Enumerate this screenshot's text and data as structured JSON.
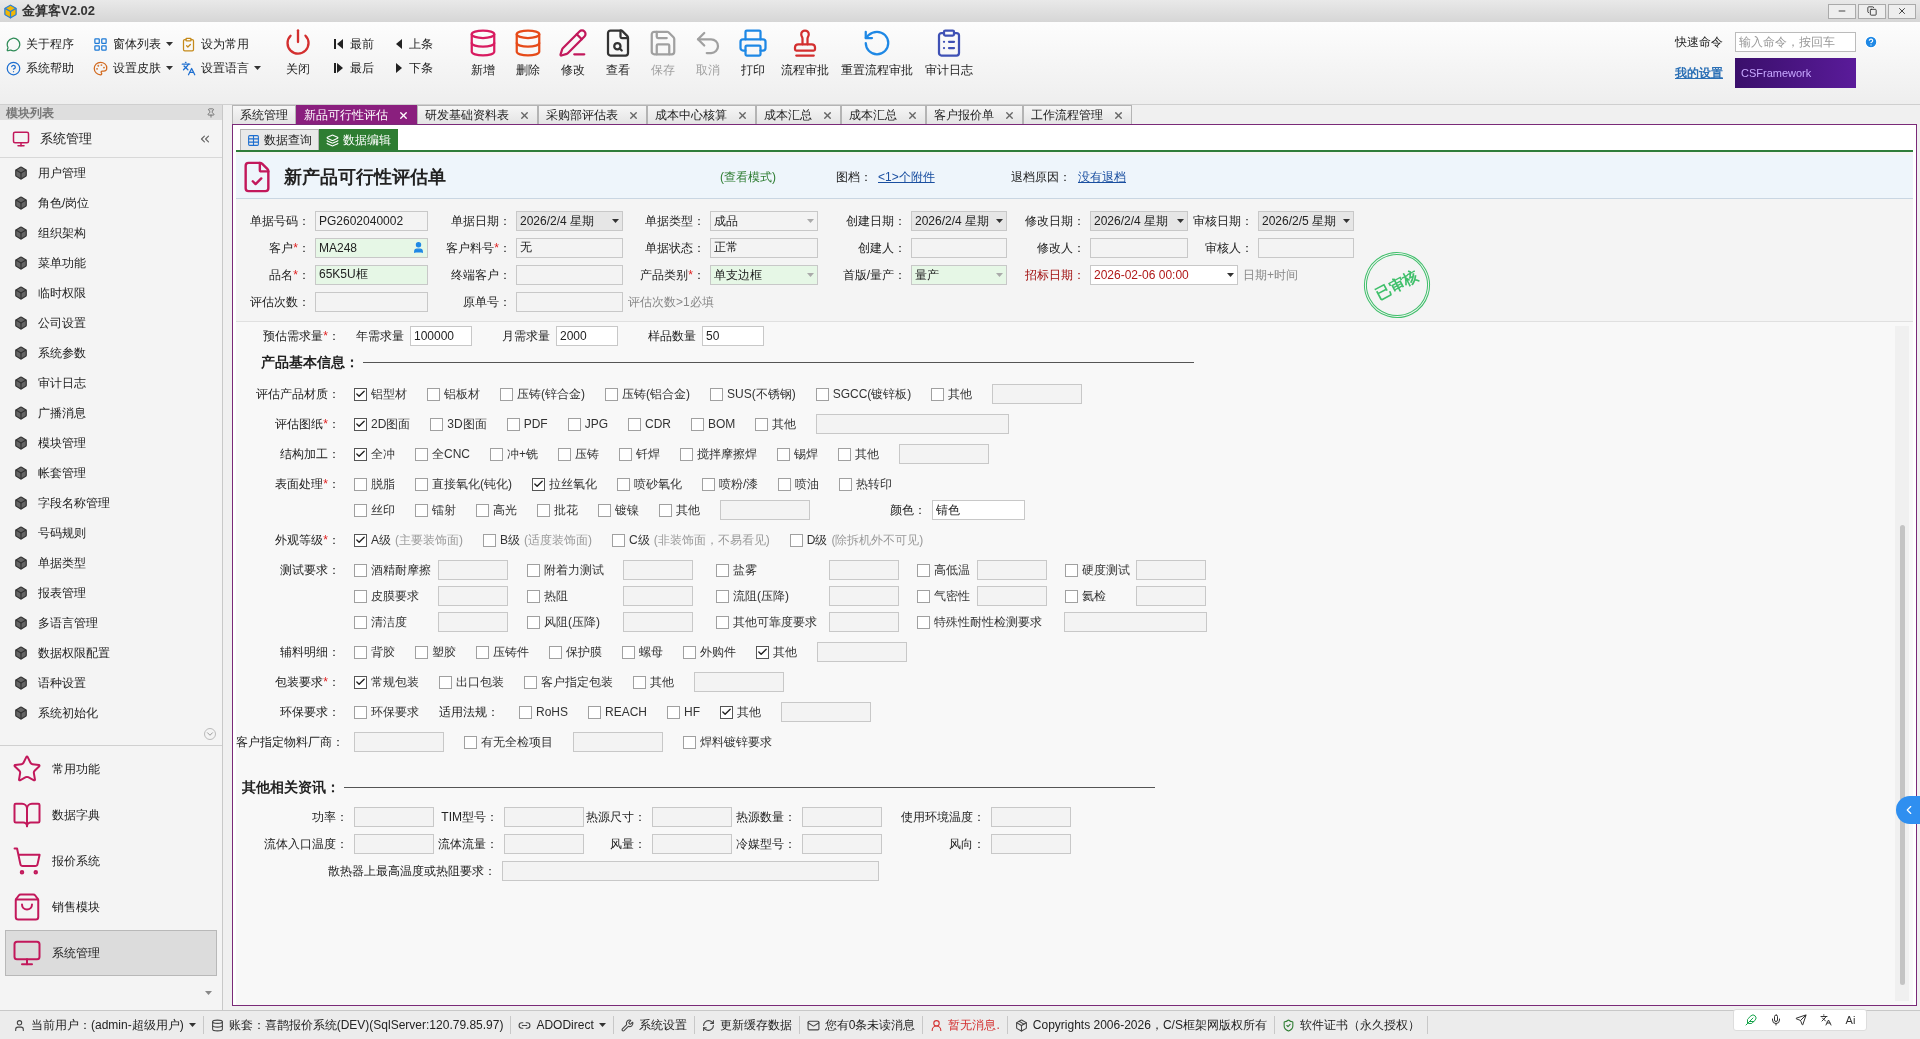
{
  "window": {
    "title": "金算客V2.02"
  },
  "ribbon": {
    "small_buttons": [
      {
        "label": "关于程序",
        "dropdown": false
      },
      {
        "label": "窗体列表",
        "dropdown": true
      },
      {
        "label": "设为常用",
        "dropdown": false
      },
      {
        "label": "系统帮助",
        "dropdown": false
      },
      {
        "label": "设置皮肤",
        "dropdown": true
      },
      {
        "label": "设置语言",
        "dropdown": true
      }
    ],
    "close_button": {
      "label": "关闭"
    },
    "nav_buttons": [
      {
        "label": "最前"
      },
      {
        "label": "上条"
      },
      {
        "label": "最后"
      },
      {
        "label": "下条"
      }
    ],
    "buttons": [
      {
        "label": "新增",
        "disabled": false
      },
      {
        "label": "删除",
        "disabled": false
      },
      {
        "label": "修改",
        "disabled": false
      },
      {
        "label": "查看",
        "disabled": false
      },
      {
        "label": "保存",
        "disabled": true
      },
      {
        "label": "取消",
        "disabled": true
      },
      {
        "label": "打印",
        "disabled": false
      },
      {
        "label": "流程审批",
        "disabled": false
      },
      {
        "label": "重置流程审批",
        "disabled": false
      },
      {
        "label": "审计日志",
        "disabled": false
      }
    ],
    "quick_command": {
      "label": "快速命令",
      "placeholder": "输入命令，按回车"
    },
    "settings_link": "我的设置",
    "banner": "CSFramework"
  },
  "sidebar": {
    "title": "模块列表",
    "group": "系统管理",
    "items": [
      {
        "label": "用户管理"
      },
      {
        "label": "角色/岗位"
      },
      {
        "label": "组织架构"
      },
      {
        "label": "菜单功能"
      },
      {
        "label": "临时权限"
      },
      {
        "label": "公司设置"
      },
      {
        "label": "系统参数"
      },
      {
        "label": "审计日志"
      },
      {
        "label": "广播消息"
      },
      {
        "label": "模块管理"
      },
      {
        "label": "帐套管理"
      },
      {
        "label": "字段名称管理"
      },
      {
        "label": "号码规则"
      },
      {
        "label": "单据类型"
      },
      {
        "label": "报表管理"
      },
      {
        "label": "多语言管理"
      },
      {
        "label": "数据权限配置"
      },
      {
        "label": "语种设置"
      },
      {
        "label": "系统初始化"
      }
    ],
    "modules": [
      {
        "label": "常用功能",
        "selected": false
      },
      {
        "label": "数据字典",
        "selected": false
      },
      {
        "label": "报价系统",
        "selected": false
      },
      {
        "label": "销售模块",
        "selected": false
      },
      {
        "label": "系统管理",
        "selected": true
      }
    ]
  },
  "tabs": [
    {
      "label": "系统管理",
      "selected": false,
      "closable": false
    },
    {
      "label": "新品可行性评估",
      "selected": true,
      "closable": true
    },
    {
      "label": "研发基础资料表",
      "selected": false,
      "closable": true
    },
    {
      "label": "采购部评估表",
      "selected": false,
      "closable": true
    },
    {
      "label": "成本中心核算",
      "selected": false,
      "closable": true
    },
    {
      "label": "成本汇总",
      "selected": false,
      "closable": true
    },
    {
      "label": "成本汇总",
      "selected": false,
      "closable": true
    },
    {
      "label": "客户报价单",
      "selected": false,
      "closable": true
    },
    {
      "label": "工作流程管理",
      "selected": false,
      "closable": true
    }
  ],
  "view_tabs": [
    {
      "label": "数据查询",
      "selected": false
    },
    {
      "label": "数据编辑",
      "selected": true
    }
  ],
  "form": {
    "title": "新产品可行性评估单",
    "mode": "(查看模式)",
    "attachments_label": "图档：",
    "attachments_link": "<1>个附件",
    "return_label": "退档原因：",
    "return_link": "没有退档",
    "stamp": "已审核",
    "header_rows": [
      [
        {
          "label": "单据号码：",
          "kind": "text",
          "value": "PG2602040002",
          "highlighted": false,
          "emphasis": false
        },
        {
          "label": "单据日期：",
          "kind": "date",
          "value": "2026/2/4 星期",
          "highlighted": false,
          "emphasis": false
        },
        {
          "label": "单据类型：",
          "kind": "dropdown",
          "value": "成品",
          "highlighted": false,
          "emphasis": false
        },
        {
          "label": "创建日期：",
          "kind": "date",
          "value": "2026/2/4 星期",
          "highlighted": false,
          "emphasis": false
        },
        {
          "label": "修改日期：",
          "kind": "date",
          "value": "2026/2/4 星期",
          "highlighted": false,
          "emphasis": false
        },
        {
          "label": "审核日期：",
          "kind": "date",
          "value": "2026/2/5 星期",
          "highlighted": false,
          "emphasis": false
        }
      ],
      [
        {
          "label": "客户",
          "mark": "*",
          "colon": "：",
          "kind": "lookup",
          "value": "MA248",
          "highlighted": true,
          "emphasis": false
        },
        {
          "label": "客户料号",
          "mark": "*",
          "colon": "：",
          "kind": "text",
          "value": "无",
          "highlighted": false,
          "emphasis": false
        },
        {
          "label": "单据状态：",
          "kind": "text",
          "value": "正常",
          "highlighted": false,
          "emphasis": false
        },
        {
          "label": "创建人：",
          "kind": "text",
          "highlighted": false,
          "emphasis": false
        },
        {
          "label": "修改人：",
          "kind": "text",
          "highlighted": false,
          "emphasis": false
        },
        {
          "label": "审核人：",
          "kind": "text",
          "highlighted": false,
          "emphasis": false
        }
      ],
      [
        {
          "label": "品名",
          "mark": "*",
          "colon": "：",
          "kind": "text",
          "value": "65K5U框",
          "highlighted": true,
          "emphasis": false
        },
        {
          "label": "终端客户：",
          "kind": "text",
          "highlighted": false,
          "emphasis": false
        },
        {
          "label": "产品类别",
          "mark": "*",
          "colon": "：",
          "kind": "dropdown",
          "value": "单支边框",
          "highlighted": true,
          "emphasis": false
        },
        {
          "label": "首版/量产：",
          "kind": "dropdown",
          "value": "量产",
          "highlighted": true,
          "emphasis": false
        },
        {
          "label": "招标日期：",
          "kind": "datetime",
          "value": "2026-02-06 00:00",
          "hint": "日期+时间",
          "highlighted": false,
          "emphasis": true
        }
      ],
      [
        {
          "label": "评估次数：",
          "kind": "text",
          "highlighted": false,
          "emphasis": false
        },
        {
          "label": "原单号：",
          "kind": "text",
          "hint": "评估次数>1必填",
          "highlighted": false,
          "emphasis": false
        }
      ]
    ],
    "demand": {
      "label": "预估需求量",
      "mark": "*",
      "colon": "：",
      "fields": [
        {
          "label": "年需求量",
          "value": "100000"
        },
        {
          "label": "月需求量",
          "value": "2000"
        },
        {
          "label": "样品数量",
          "value": "50"
        }
      ]
    },
    "basic_info": {
      "title": "产品基本信息：",
      "rows": [
        {
          "label": "评估产品材质：",
          "lines": [
            [
              {
                "kind": "check",
                "label": "铝型材",
                "checked": true
              },
              {
                "kind": "check",
                "label": "铝板材",
                "checked": false
              },
              {
                "kind": "check",
                "label": "压铸(锌合金)",
                "checked": false
              },
              {
                "kind": "check",
                "label": "压铸(铝合金)",
                "checked": false
              },
              {
                "kind": "check",
                "label": "SUS(不锈钢)",
                "checked": false
              },
              {
                "kind": "check",
                "label": "SGCC(镀锌板)",
                "checked": false
              },
              {
                "kind": "check",
                "label": "其他",
                "checked": false
              },
              {
                "kind": "field"
              }
            ]
          ]
        },
        {
          "label": "评估图纸",
          "mark": "*",
          "colon": "：",
          "lines": [
            [
              {
                "kind": "check",
                "label": "2D图面",
                "checked": true
              },
              {
                "kind": "check",
                "label": "3D图面",
                "checked": false
              },
              {
                "kind": "check",
                "label": "PDF",
                "checked": false
              },
              {
                "kind": "check",
                "label": "JPG",
                "checked": false
              },
              {
                "kind": "check",
                "label": "CDR",
                "checked": false
              },
              {
                "kind": "check",
                "label": "BOM",
                "checked": false
              },
              {
                "kind": "check",
                "label": "其他",
                "checked": false
              },
              {
                "kind": "wide_field"
              }
            ]
          ]
        },
        {
          "label": "结构加工：",
          "lines": [
            [
              {
                "kind": "check",
                "label": "全冲",
                "checked": true
              },
              {
                "kind": "check",
                "label": "全CNC",
                "checked": false
              },
              {
                "kind": "check",
                "label": "冲+铣",
                "checked": false
              },
              {
                "kind": "check",
                "label": "压铸",
                "checked": false
              },
              {
                "kind": "check",
                "label": "钎焊",
                "checked": false
              },
              {
                "kind": "check",
                "label": "搅拌摩擦焊",
                "checked": false
              },
              {
                "kind": "check",
                "label": "锡焊",
                "checked": false
              },
              {
                "kind": "check",
                "label": "其他",
                "checked": false
              },
              {
                "kind": "field"
              }
            ]
          ]
        },
        {
          "label": "表面处理",
          "mark": "*",
          "colon": "：",
          "lines": [
            [
              {
                "kind": "check",
                "label": "脱脂",
                "checked": false
              },
              {
                "kind": "check",
                "label": "直接氧化(钝化)",
                "checked": false
              },
              {
                "kind": "check",
                "label": "拉丝氧化",
                "checked": true
              },
              {
                "kind": "check",
                "label": "喷砂氧化",
                "checked": false
              },
              {
                "kind": "check",
                "label": "喷粉/漆",
                "checked": false
              },
              {
                "kind": "check",
                "label": "喷油",
                "checked": false
              },
              {
                "kind": "check",
                "label": "热转印",
                "checked": false
              }
            ],
            [
              {
                "kind": "check",
                "label": "丝印",
                "checked": false
              },
              {
                "kind": "check",
                "label": "镭射",
                "checked": false
              },
              {
                "kind": "check",
                "label": "高光",
                "checked": false
              },
              {
                "kind": "check",
                "label": "批花",
                "checked": false
              },
              {
                "kind": "check",
                "label": "镀镍",
                "checked": false
              },
              {
                "kind": "check",
                "label": "其他",
                "checked": false
              },
              {
                "kind": "field"
              },
              {
                "kind": "labeled_field",
                "label": "颜色：",
                "value": "锖色"
              }
            ]
          ]
        },
        {
          "label": "外观等级",
          "mark": "*",
          "colon": "：",
          "lines": [
            [
              {
                "kind": "check",
                "label": "A级",
                "note": "(主要装饰面)",
                "checked": true
              },
              {
                "kind": "check",
                "label": "B级",
                "note": "(适度装饰面)",
                "checked": false
              },
              {
                "kind": "check",
                "label": "C级",
                "note": "(非装饰面，不易看见)",
                "checked": false
              },
              {
                "kind": "check",
                "label": "D级",
                "note": "(除拆机外不可见)",
                "checked": false
              }
            ]
          ]
        },
        {
          "label": "测试要求：",
          "lines": [
            [
              {
                "kind": "check_field",
                "label": "酒精耐摩擦",
                "checked": false
              },
              {
                "kind": "check_field",
                "label": "附着力测试",
                "checked": false
              },
              {
                "kind": "check_field",
                "label": "盐雾",
                "checked": false
              },
              {
                "kind": "check_field",
                "label": "高低温",
                "checked": false
              },
              {
                "kind": "check_field",
                "label": "硬度测试",
                "checked": false
              }
            ],
            [
              {
                "kind": "check_field",
                "label": "皮膜要求",
                "checked": false
              },
              {
                "kind": "check_field",
                "label": "热阻",
                "checked": false
              },
              {
                "kind": "check_field",
                "label": "流阻(压降)",
                "checked": false
              },
              {
                "kind": "check_field",
                "label": "气密性",
                "checked": false
              },
              {
                "kind": "check_field",
                "label": "氦检",
                "checked": false
              }
            ],
            [
              {
                "kind": "check_field",
                "label": "清洁度",
                "checked": false
              },
              {
                "kind": "check_field",
                "label": "风阻(压降)",
                "checked": false
              },
              {
                "kind": "check_field",
                "label": "其他可靠度要求",
                "checked": false
              },
              {
                "kind": "check_wide_field",
                "label": "特殊性耐性检测要求",
                "checked": false
              }
            ]
          ]
        },
        {
          "label": "辅料明细：",
          "lines": [
            [
              {
                "kind": "check",
                "label": "背胶",
                "checked": false
              },
              {
                "kind": "check",
                "label": "塑胶",
                "checked": false
              },
              {
                "kind": "check",
                "label": "压铸件",
                "checked": false
              },
              {
                "kind": "check",
                "label": "保护膜",
                "checked": false
              },
              {
                "kind": "check",
                "label": "螺母",
                "checked": false
              },
              {
                "kind": "check",
                "label": "外购件",
                "checked": false
              },
              {
                "kind": "check",
                "label": "其他",
                "checked": true
              },
              {
                "kind": "field"
              }
            ]
          ]
        },
        {
          "label": "包装要求",
          "mark": "*",
          "colon": "：",
          "lines": [
            [
              {
                "kind": "check",
                "label": "常规包装",
                "checked": true
              },
              {
                "kind": "check",
                "label": "出口包装",
                "checked": false
              },
              {
                "kind": "check",
                "label": "客户指定包装",
                "checked": false
              },
              {
                "kind": "check",
                "label": "其他",
                "checked": false
              },
              {
                "kind": "field"
              }
            ]
          ]
        },
        {
          "label": "环保要求：",
          "lines": [
            [
              {
                "kind": "check",
                "label": "环保要求",
                "checked": false
              },
              {
                "kind": "text",
                "label": "适用法规："
              },
              {
                "kind": "check",
                "label": "RoHS",
                "checked": false
              },
              {
                "kind": "check",
                "label": "REACH",
                "checked": false
              },
              {
                "kind": "check",
                "label": "HF",
                "checked": false
              },
              {
                "kind": "check",
                "label": "其他",
                "checked": true
              },
              {
                "kind": "field"
              }
            ]
          ]
        },
        {
          "label": "客户指定物料厂商：",
          "lines": [
            [
              {
                "kind": "field"
              },
              {
                "kind": "check",
                "label": "有无全检项目",
                "checked": false
              },
              {
                "kind": "field"
              },
              {
                "kind": "check",
                "label": "焊料镀锌要求",
                "checked": false
              }
            ]
          ]
        }
      ]
    },
    "other_info": {
      "title": "其他相关资讯：",
      "rows": [
        [
          {
            "label": "功率：",
            "kind": "field"
          },
          {
            "label": "TIM型号：",
            "kind": "field"
          },
          {
            "label": "热源尺寸：",
            "kind": "field"
          },
          {
            "label": "热源数量：",
            "kind": "field"
          },
          {
            "label": "使用环境温度：",
            "kind": "field"
          }
        ],
        [
          {
            "label": "流体入口温度：",
            "kind": "field"
          },
          {
            "label": "流体流量：",
            "kind": "field"
          },
          {
            "label": "风量：",
            "kind": "field"
          },
          {
            "label": "冷媒型号：",
            "kind": "field"
          },
          {
            "label": "风向：",
            "kind": "field"
          }
        ],
        [
          {
            "label": "散热器上最高温度或热阻要求：",
            "kind": "wide"
          }
        ]
      ]
    }
  },
  "status_bar": [
    {
      "label": "当前用户：(admin-超级用户)",
      "dropdown": true,
      "alert": false
    },
    {
      "label": "账套：喜鹊报价系统(DEV)(SqlServer:120.79.85.97)",
      "dropdown": false,
      "alert": false
    },
    {
      "label": "ADODirect",
      "dropdown": true,
      "alert": false
    },
    {
      "label": "系统设置",
      "dropdown": false,
      "alert": false
    },
    {
      "label": "更新缓存数据",
      "dropdown": false,
      "alert": false
    },
    {
      "label": "您有0条未读消息",
      "dropdown": false,
      "alert": false
    },
    {
      "label": "暂无消息.",
      "dropdown": false,
      "alert": true
    },
    {
      "label": "Copyrights 2006-2026，C/S框架网版权所有",
      "dropdown": false,
      "alert": false
    },
    {
      "label": "软件证书（永久授权）",
      "dropdown": false,
      "alert": false
    }
  ],
  "ime_toolbar": {
    "ai_label": "Ai"
  }
}
